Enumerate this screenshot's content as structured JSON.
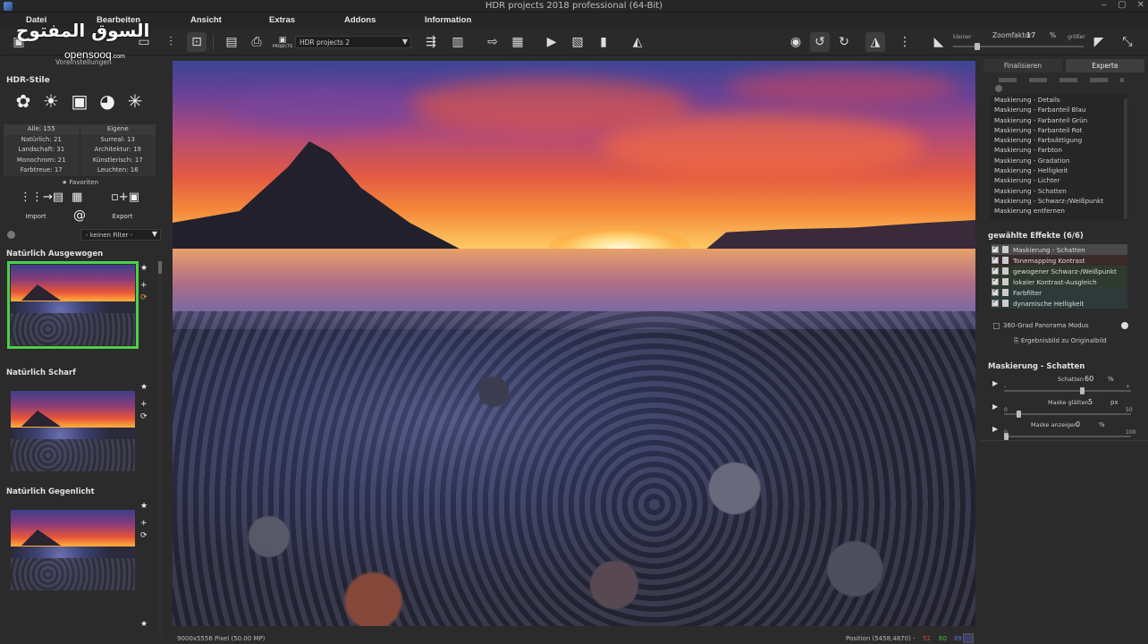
{
  "window": {
    "title": "HDR projects 2018 professional (64-Bit)",
    "controls": [
      "‒",
      "▢",
      "✕"
    ]
  },
  "watermark": {
    "arabic": "السوق المفتوح",
    "latin": "opensooq",
    "suffix": ".com"
  },
  "menu": {
    "datei": "Datei",
    "bearbeiten": "Bearbeiten",
    "ansicht": "Ansicht",
    "extras": "Extras",
    "addons": "Addons",
    "information": "Information"
  },
  "toolbar": {
    "preset_value": "HDR projects 2",
    "projects_label": "PROJECTS",
    "zoom_label": "Zoomfaktor",
    "zoom_value": "17",
    "zoom_unit": "%",
    "zoom_small": "kleiner",
    "zoom_big": "größer",
    "zoom_level": 0.17
  },
  "left": {
    "voreinstellungen": "Voreinstellungen",
    "hdr_styles_title": "HDR-Stile",
    "style_icons": [
      "natural-icon",
      "sun-icon",
      "camera-icon",
      "palette-icon",
      "sparkle-icon"
    ],
    "categories_head": [
      "Alle: 155",
      "Eigene"
    ],
    "categories": [
      [
        "Natürlich: 21",
        "Surreal: 13"
      ],
      [
        "Landschaft: 31",
        "Architektur: 19"
      ],
      [
        "Monochrom: 21",
        "Künstlerisch: 17"
      ],
      [
        "Farbtreue: 17",
        "Leuchten: 16"
      ]
    ],
    "favorites": "Favoriten",
    "import": "Import",
    "export": "Export",
    "filter": "- keinen Filter -",
    "presets": [
      {
        "title": "Natürlich Ausgewogen"
      },
      {
        "title": "Natürlich Scharf"
      },
      {
        "title": "Natürlich Gegenlicht"
      }
    ]
  },
  "status": {
    "size": "9000x5556 Pixel (50.00 MP)",
    "position": "Position  (5458,4870) -",
    "r": "52",
    "g": "60",
    "b": "89",
    "colors": {
      "r": "#e04040",
      "g": "#40c040",
      "b": "#5a6ae0",
      "swatch": "#3b3f6b"
    }
  },
  "right": {
    "tab_finalize": "Finalisieren",
    "tab_expert": "Experte",
    "effects": [
      "Maskierung - Details",
      "Maskierung - Farbanteil Blau",
      "Maskierung - Farbanteil Grün",
      "Maskierung - Farbanteil Rot",
      "Maskierung - Farbsättigung",
      "Maskierung - Farbton",
      "Maskierung - Gradation",
      "Maskierung - Helligkeit",
      "Maskierung - Lichter",
      "Maskierung - Schatten",
      "Maskierung - Schwarz-/Weißpunkt",
      "Maskierung entfernen"
    ],
    "selected_title": "gewählte Effekte (6/6)",
    "selected": [
      "Maskierung - Schatten",
      "Tonemapping Kontrast",
      "gewogener Schwarz-/Weißpunkt",
      "lokaler Kontrast-Ausgleich",
      "Farbfilter",
      "dynamische Helligkeit"
    ],
    "panorama": "360-Grad Panorama Modus",
    "result_to_original": "Ergebnisbild zu Originalbild",
    "params_title": "Maskierung - Schatten",
    "params": [
      {
        "label": "Schatten",
        "value": "60",
        "unit": "%",
        "min": "-",
        "max": "+",
        "level": 0.62
      },
      {
        "label": "Maske glätten",
        "value": "5",
        "unit": "px",
        "min": "0",
        "max": "50",
        "level": 0.1
      },
      {
        "label": "Maske anzeigen",
        "value": "0",
        "unit": "%",
        "min": "0",
        "max": "100",
        "level": 0.0
      }
    ]
  }
}
